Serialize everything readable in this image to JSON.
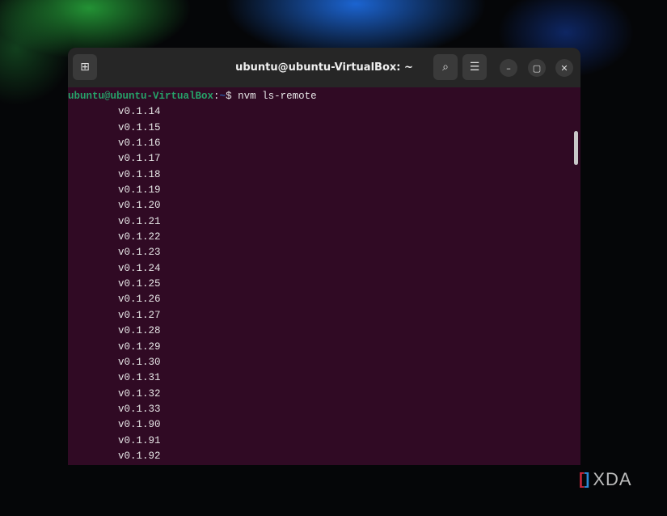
{
  "window": {
    "title": "ubuntu@ubuntu-VirtualBox: ~"
  },
  "prompt": {
    "user_host": "ubuntu@ubuntu-VirtualBox",
    "sep": ":",
    "path": "~",
    "symbol": "$",
    "command": " nvm ls-remote"
  },
  "versions": [
    "v0.1.14",
    "v0.1.15",
    "v0.1.16",
    "v0.1.17",
    "v0.1.18",
    "v0.1.19",
    "v0.1.20",
    "v0.1.21",
    "v0.1.22",
    "v0.1.23",
    "v0.1.24",
    "v0.1.25",
    "v0.1.26",
    "v0.1.27",
    "v0.1.28",
    "v0.1.29",
    "v0.1.30",
    "v0.1.31",
    "v0.1.32",
    "v0.1.33",
    "v0.1.90",
    "v0.1.91",
    "v0.1.92"
  ],
  "watermark": "XDA",
  "colors": {
    "terminal_bg": "#300a24",
    "prompt_user": "#26a269",
    "prompt_path": "#2a7bde"
  }
}
